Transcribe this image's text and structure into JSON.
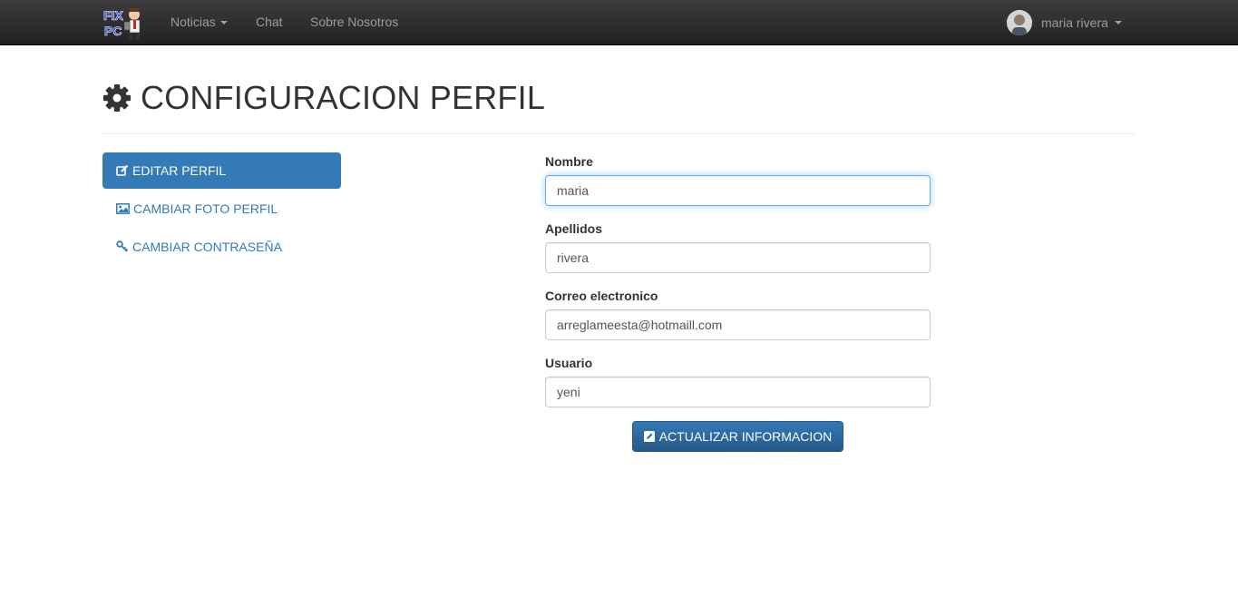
{
  "navbar": {
    "brand": {
      "line1": "FIX",
      "line2": "PC"
    },
    "items": [
      {
        "label": "Noticias",
        "dropdown": true
      },
      {
        "label": "Chat",
        "dropdown": false
      },
      {
        "label": "Sobre Nosotros",
        "dropdown": false
      }
    ],
    "user": {
      "name": "maria rivera",
      "dropdown": true
    }
  },
  "page": {
    "title": "CONFIGURACION PERFIL",
    "title_icon": "gear-icon"
  },
  "sidebar": {
    "items": [
      {
        "label": "EDITAR PERFIL",
        "icon": "edit-icon",
        "active": true
      },
      {
        "label": "CAMBIAR FOTO PERFIL",
        "icon": "picture-icon",
        "active": false
      },
      {
        "label": "CAMBIAR CONTRASEÑA",
        "icon": "key-icon",
        "active": false
      }
    ]
  },
  "form": {
    "fields": [
      {
        "label": "Nombre",
        "value": "maria",
        "focused": true
      },
      {
        "label": "Apellidos",
        "value": "rivera",
        "focused": false
      },
      {
        "label": "Correo electronico",
        "value": "arreglameesta@hotmaill.com",
        "focused": false
      },
      {
        "label": "Usuario",
        "value": "yeni",
        "focused": false
      }
    ],
    "submit_label": "ACTUALIZAR INFORMACION",
    "submit_icon": "pencil-square-icon"
  },
  "colors": {
    "navbar_bg": "#222222",
    "navbar_text": "#9d9d9d",
    "primary": "#337ab7",
    "link": "#337ab7",
    "input_focus": "#66afe9"
  }
}
